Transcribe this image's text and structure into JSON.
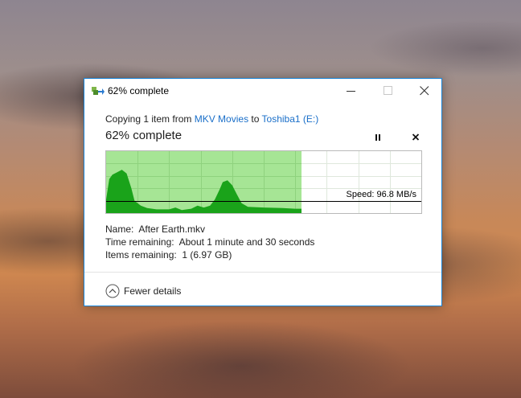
{
  "window": {
    "title": "62% complete",
    "accent_color": "#1883d7"
  },
  "transfer": {
    "copy_prefix": "Copying 1 item from ",
    "source": "MKV Movies",
    "to_word": " to ",
    "destination": "Toshiba1 (E:)",
    "status": "62% complete",
    "progress_percent": 62,
    "speed_label": "Speed: 96.8 MB/s",
    "speed_level_percent": 19,
    "graph_fill_color": "#a6e595",
    "graph_speed_color": "#1aa31a"
  },
  "details": {
    "name_label": "Name:",
    "name_value": "After Earth.mkv",
    "time_label": "Time remaining:",
    "time_value": "About 1 minute and 30 seconds",
    "items_label": "Items remaining:",
    "items_value": "1 (6.97 GB)"
  },
  "footer": {
    "toggle_label": "Fewer details"
  },
  "icons": {
    "app": "copy-transfer-icon",
    "minimize": "minimize-icon",
    "maximize": "maximize-icon",
    "close": "close-icon",
    "pause": "pause-icon",
    "cancel": "cancel-icon",
    "collapse": "chevron-up-circle-icon"
  }
}
